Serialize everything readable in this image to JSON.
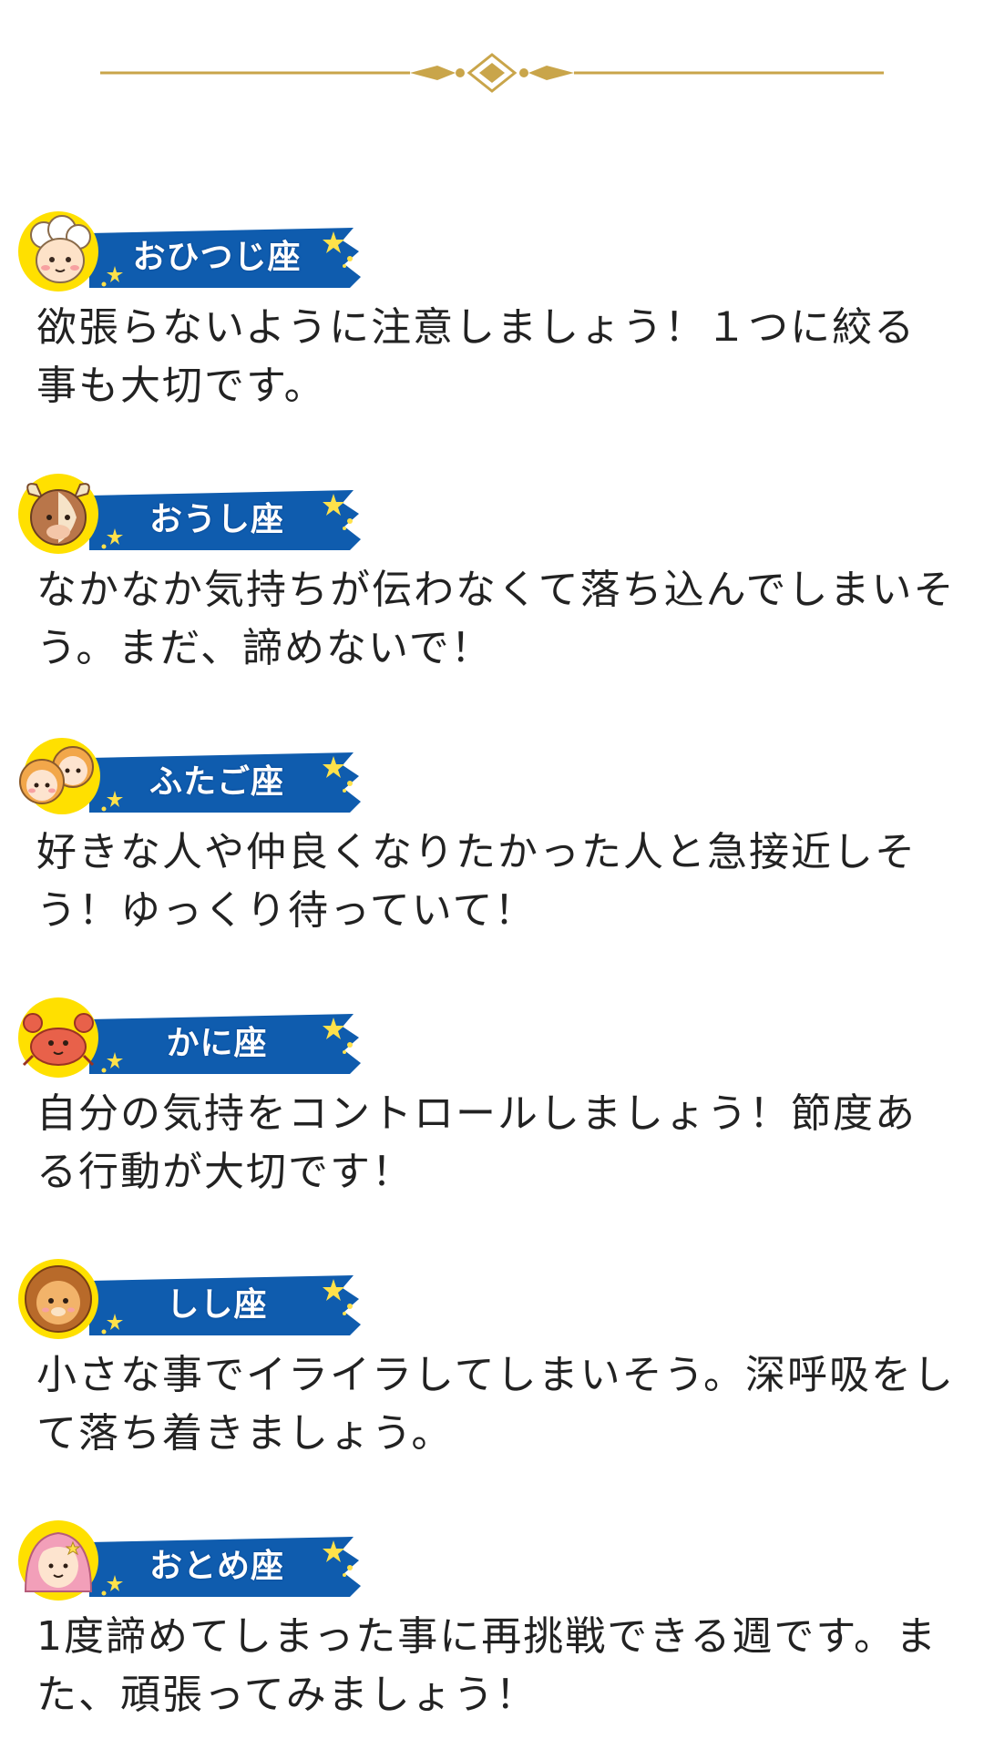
{
  "colors": {
    "ribbon": "#0f5cae",
    "avatar_bg": "#ffe000",
    "star": "#ffe14a",
    "divider": "#c9a54a",
    "text": "#222222"
  },
  "entries": [
    {
      "sign": "おひつじ座",
      "icon": "ram-icon",
      "text": "欲張らないように注意しましょう！１つに絞る事も大切です。"
    },
    {
      "sign": "おうし座",
      "icon": "bull-icon",
      "text": "なかなか気持ちが伝わなくて落ち込んでしまいそう。まだ、諦めないで！"
    },
    {
      "sign": "ふたご座",
      "icon": "twins-icon",
      "text": "好きな人や仲良くなりたかった人と急接近しそう！ゆっくり待っていて！"
    },
    {
      "sign": "かに座",
      "icon": "crab-icon",
      "text": "自分の気持をコントロールしましょう！節度ある行動が大切です！"
    },
    {
      "sign": "しし座",
      "icon": "lion-icon",
      "text": "小さな事でイライラしてしまいそう。深呼吸をして落ち着きましょう。"
    },
    {
      "sign": "おとめ座",
      "icon": "maiden-icon",
      "text": "1度諦めてしまった事に再挑戦できる週です。また、頑張ってみましょう！"
    }
  ]
}
